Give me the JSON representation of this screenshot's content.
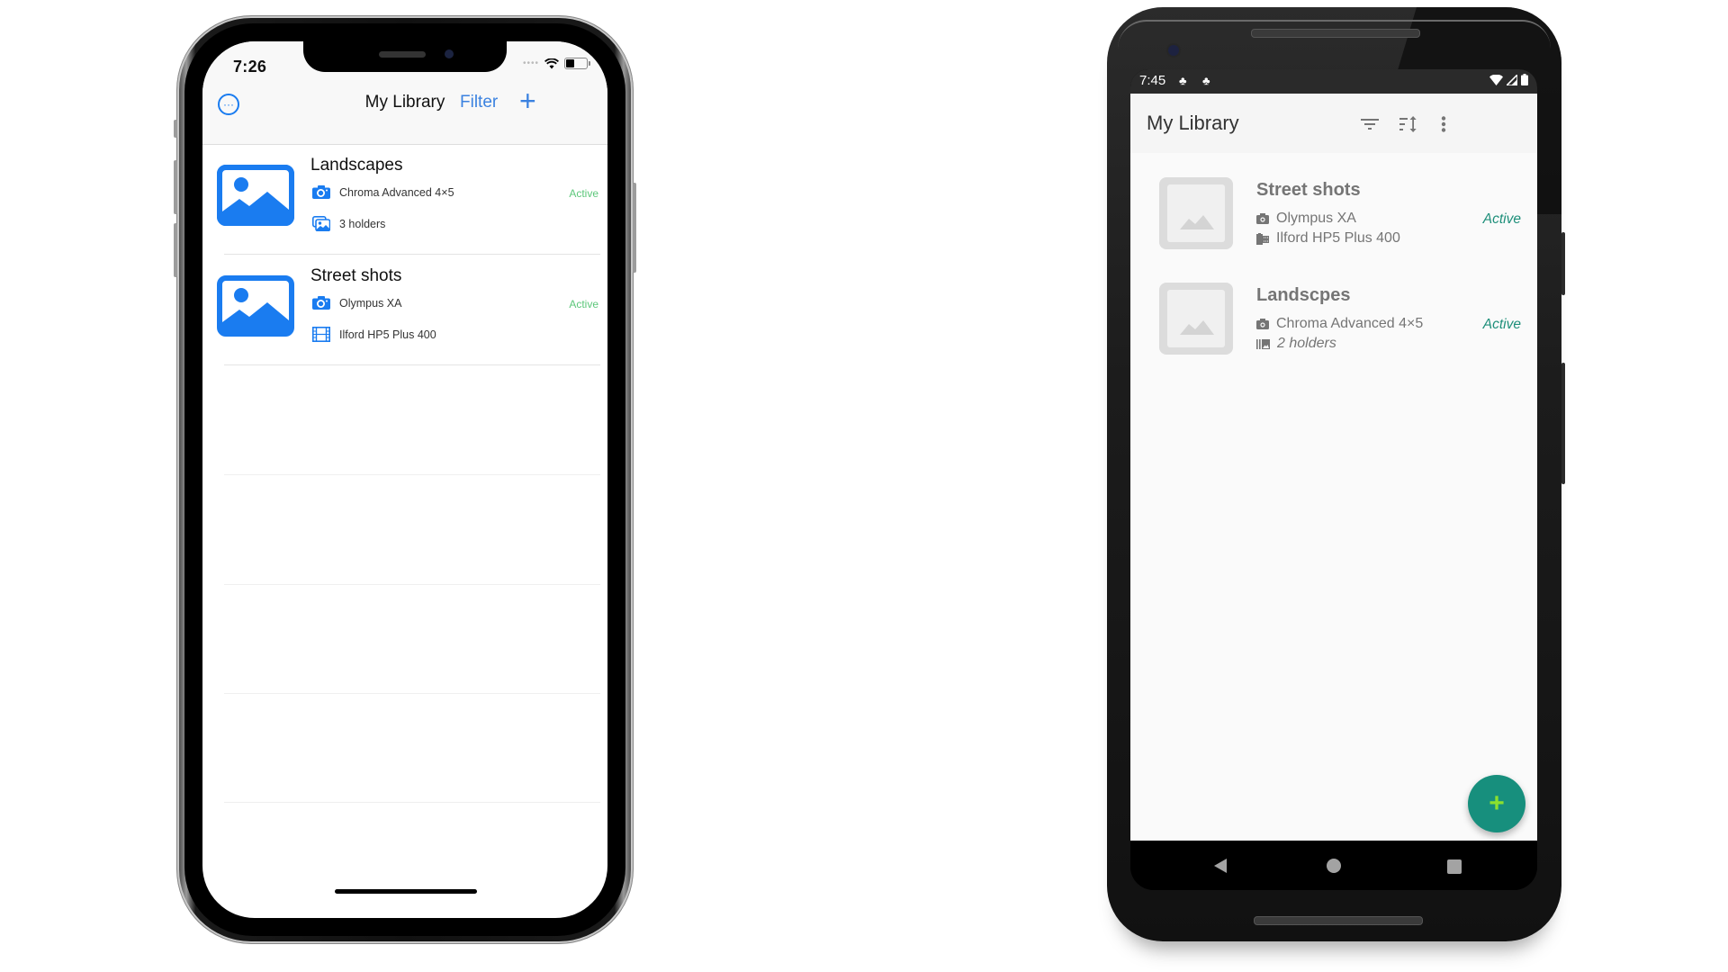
{
  "ios": {
    "status_time": "7:26",
    "nav": {
      "title": "My Library",
      "filter_label": "Filter",
      "add_label": "+",
      "more_label": "···"
    },
    "items": [
      {
        "title": "Landscapes",
        "camera": "Chroma Advanced 4×5",
        "detail": "3 holders",
        "detail_icon": "photo-stack-icon",
        "status": "Active"
      },
      {
        "title": "Street shots",
        "camera": "Olympus XA",
        "detail": "Ilford HP5 Plus  400",
        "detail_icon": "film-icon",
        "status": "Active"
      }
    ],
    "colors": {
      "accent": "#1a7cf0",
      "active": "#5cc77a"
    }
  },
  "android": {
    "status_time": "7:45",
    "toolbar": {
      "title": "My Library",
      "actions": [
        "filter-icon",
        "sort-icon",
        "overflow-menu-icon"
      ]
    },
    "items": [
      {
        "title": "Street shots",
        "camera": "Olympus XA",
        "detail": "Ilford HP5 Plus  400",
        "detail_icon": "film-roll-icon",
        "status": "Active"
      },
      {
        "title": "Landscpes",
        "camera": "Chroma Advanced 4×5",
        "detail": "2 holders",
        "detail_icon": "holders-icon",
        "status": "Active"
      }
    ],
    "fab_label": "+",
    "colors": {
      "fab": "#178f7d",
      "fab_icon": "#8be02e",
      "active": "#1e8f7a"
    }
  }
}
